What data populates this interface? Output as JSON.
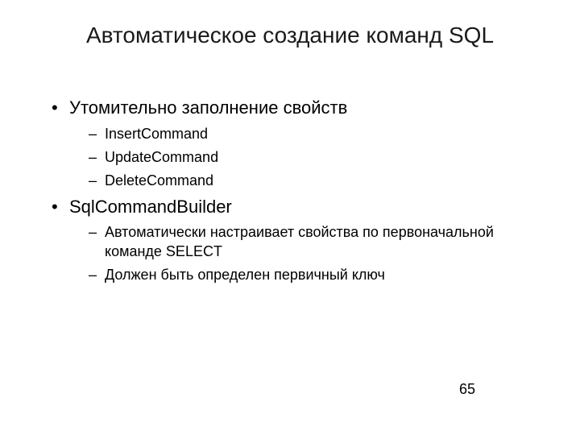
{
  "title": "Автоматическое создание команд SQL",
  "bullets": [
    {
      "text": "Утомительно заполнение свойств",
      "sub": [
        "InsertCommand",
        "UpdateCommand",
        "DeleteCommand"
      ]
    },
    {
      "text": "SqlCommandBuilder",
      "sub": [
        "Автоматически настраивает свойства по первоначальной команде SELECT",
        "Должен быть определен первичный ключ"
      ]
    }
  ],
  "page_number": "65"
}
